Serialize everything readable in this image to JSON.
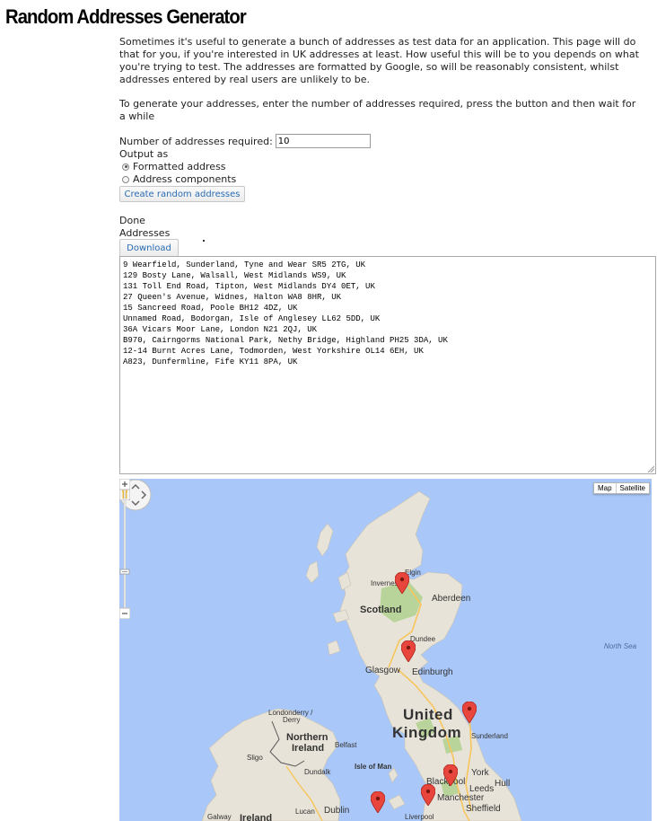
{
  "page": {
    "title": "Random Addresses Generator",
    "intro": "Sometimes it's useful to generate a bunch of addresses as test data for an application. This page will do that for you, if you're interested in UK addresses at least. How useful this will be to you depends on what you're trying to test. The addresses are formatted by Google, so will be reasonably consistent, whilst addresses entered by real users are unlikely to be.",
    "instructions": "To generate your addresses, enter the number of addresses required, press the button and then wait for a while"
  },
  "form": {
    "count_label": "Number of addresses required:",
    "count_value": "10",
    "output_label": "Output as",
    "options": [
      {
        "label": "Formatted address",
        "checked": true
      },
      {
        "label": "Address components",
        "checked": false
      }
    ],
    "create_button": "Create random addresses"
  },
  "results": {
    "status": "Done",
    "addresses_label": "Addresses",
    "download_button": "Download",
    "addresses": [
      "9 Wearfield, Sunderland, Tyne and Wear SR5 2TG, UK",
      "129 Bosty Lane, Walsall, West Midlands WS9, UK",
      "131 Toll End Road, Tipton, West Midlands DY4 0ET, UK",
      "27 Queen's Avenue, Widnes, Halton WA8 8HR, UK",
      "15 Sancreed Road, Poole BH12 4DZ, UK",
      "Unnamed Road, Bodorgan, Isle of Anglesey LL62 5DD, UK",
      "36A Vicars Moor Lane, London N21 2QJ, UK",
      "B970, Cairngorms National Park, Nethy Bridge, Highland PH25 3DA, UK",
      "12-14 Burnt Acres Lane, Todmorden, West Yorkshire OL14 6EH, UK",
      "A823, Dunfermline, Fife KY11 8PA, UK"
    ]
  },
  "map": {
    "type_buttons": {
      "map": "Map",
      "satellite": "Satellite"
    },
    "labels": {
      "elgin": "Elgin",
      "inverness": "Inverness",
      "aberdeen": "Aberdeen",
      "scotland": "Scotland",
      "dundee": "Dundee",
      "glasgow": "Glasgow",
      "edinburgh": "Edinburgh",
      "north_sea": "North Sea",
      "united": "United",
      "kingdom": "Kingdom",
      "londonderry": "Londonderry /",
      "derry": "Derry",
      "northern": "Northern",
      "ireland_ni": "Ireland",
      "belfast": "Belfast",
      "sunderland": "Sunderland",
      "sligo": "Sligo",
      "dundalk": "Dundalk",
      "isle_of_man": "Isle of Man",
      "york": "York",
      "blackpool": "Blackpool",
      "leeds": "Leeds",
      "hull": "Hull",
      "manchester": "Manchester",
      "galway": "Galway",
      "ireland": "Ireland",
      "lucan": "Lucan",
      "dublin": "Dublin",
      "liverpool": "Liverpool",
      "sheffield": "Sheffield"
    },
    "colors": {
      "sea": "#a9c8f9",
      "land": "#e8e3d8",
      "park": "#b9d49b",
      "road": "#f7c55b",
      "marker": "#e8453c"
    },
    "icons": [
      "pan-control-icon",
      "pegman-icon",
      "zoom-in-icon",
      "zoom-out-icon",
      "map-marker-icon"
    ]
  }
}
